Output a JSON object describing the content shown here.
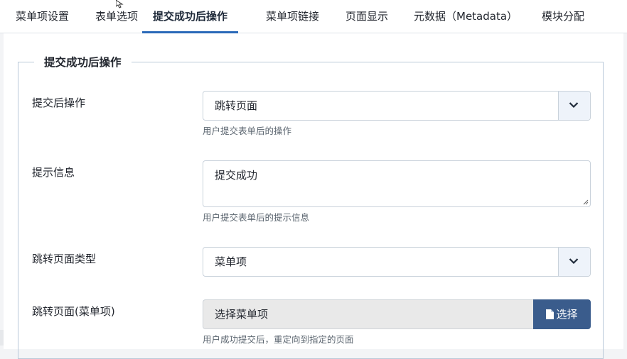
{
  "tabs": [
    {
      "label": "菜单项设置"
    },
    {
      "label": "表单选项"
    },
    {
      "label": "提交成功后操作"
    },
    {
      "label": "菜单项链接"
    },
    {
      "label": "页面显示"
    },
    {
      "label": "元数据（Metadata）"
    },
    {
      "label": "模块分配"
    }
  ],
  "active_tab": "提交成功后操作",
  "section": {
    "legend": "提交成功后操作"
  },
  "fields": {
    "after_submit": {
      "label": "提交后操作",
      "value": "跳转页面",
      "hint": "用户提交表单后的操作"
    },
    "message": {
      "label": "提示信息",
      "value": "提交成功",
      "hint": "用户提交表单后的提示信息"
    },
    "redirect_type": {
      "label": "跳转页面类型",
      "value": "菜单项"
    },
    "redirect_menu_item": {
      "label": "跳转页面(菜单项)",
      "value": "选择菜单项",
      "button_label": "选择",
      "hint": "用户成功提交后，重定向到指定的页面"
    }
  },
  "colors": {
    "accent": "#2a69b8",
    "select_button": "#3a5c8c",
    "border": "#c9d2db"
  },
  "icons": {
    "caret": "chevron-down-icon",
    "file": "file-icon"
  }
}
